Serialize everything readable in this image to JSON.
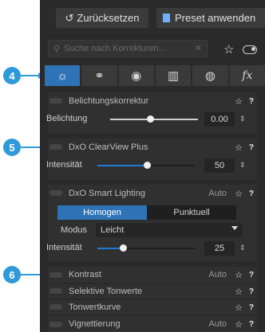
{
  "toolbar": {
    "reset_label": "Zurücksetzen",
    "preset_label": "Preset anwenden"
  },
  "search": {
    "placeholder": "Suche nach Korrekturen..."
  },
  "tabs": [
    {
      "icon": "sun-icon",
      "symbol": "☼",
      "active": true
    },
    {
      "icon": "color-circles-icon",
      "symbol": "⚭",
      "active": false
    },
    {
      "icon": "detail-icon",
      "symbol": "◉",
      "active": false
    },
    {
      "icon": "geometry-icon",
      "symbol": "▥",
      "active": false
    },
    {
      "icon": "local-adjust-icon",
      "symbol": "◍",
      "active": false
    },
    {
      "icon": "fx-icon",
      "symbol": "fx",
      "active": false
    }
  ],
  "sections": {
    "belichtung": {
      "title": "Belichtungskorrektur",
      "slider_label": "Belichtung",
      "value": "0.00",
      "level": 0.5
    },
    "clearview": {
      "title": "DxO ClearView Plus",
      "slider_label": "Intensität",
      "value": "50",
      "level": 0.5
    },
    "smartlighting": {
      "title": "DxO Smart Lighting",
      "auto": "Auto",
      "mode_a": "Homogen",
      "mode_b": "Punktuell",
      "modus_label": "Modus",
      "modus_value": "Leicht",
      "slider_label": "Intensität",
      "value": "25",
      "level": 0.25
    },
    "kontrast": {
      "title": "Kontrast",
      "auto": "Auto"
    },
    "selektive": {
      "title": "Selektive Tonwerte"
    },
    "tonwert": {
      "title": "Tonwertkurve"
    },
    "vignett": {
      "title": "Vignettierung",
      "auto": "Auto"
    }
  },
  "callouts": [
    "4",
    "5",
    "6"
  ],
  "colors": {
    "accent": "#2f73b7",
    "callout": "#2f9ad9",
    "slider_blue": "#1f7ad6"
  }
}
